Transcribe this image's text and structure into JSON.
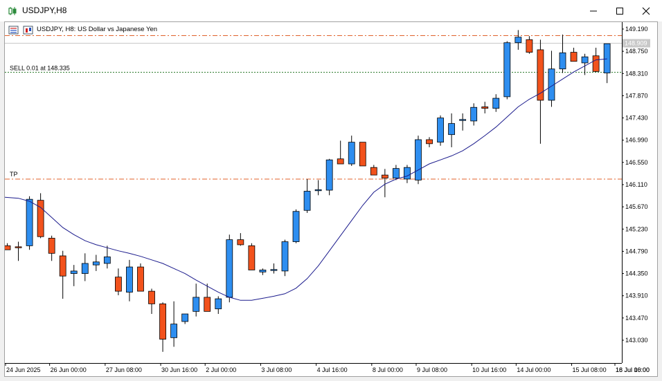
{
  "window": {
    "title": "USDJPY,H8",
    "buttons": [
      "minimize",
      "maximize",
      "close"
    ]
  },
  "chart_header": {
    "symbol_text": "USDJPY, H8:  US Dollar vs Japanese Yen"
  },
  "trade_lines": {
    "sell_label": "SELL 0.01 at 148.335",
    "tp_label": "TP",
    "sell_price": 148.335,
    "tp_price": 146.22,
    "sl_price": 149.06,
    "current_price": 148.909,
    "current_price_label": "148.909"
  },
  "colors": {
    "bull": "#2e8ef0",
    "bear": "#f2521c",
    "ma": "#1a1a8c",
    "tp_sl_line": "#e0602a",
    "sell_line": "#2a7a2a",
    "price_line": "#c8c8c8"
  },
  "chart_data": {
    "type": "candlestick",
    "symbol": "USDJPY",
    "timeframe": "H8",
    "y_axis_ticks": [
      "149.190",
      "148.750",
      "148.310",
      "147.870",
      "147.430",
      "146.990",
      "146.550",
      "146.110",
      "145.670",
      "145.230",
      "144.790",
      "144.350",
      "143.910",
      "143.470",
      "143.030"
    ],
    "x_axis_labels": [
      "24 Jun 2025",
      "26 Jun 00:00",
      "27 Jun 08:00",
      "30 Jun 16:00",
      "2 Jul 00:00",
      "3 Jul 08:00",
      "4 Jul 16:00",
      "8 Jul 00:00",
      "9 Jul 08:00",
      "10 Jul 16:00",
      "14 Jul 00:00",
      "15 Jul 08:00",
      "16 Jul 16:00",
      "18 Jul 00:00"
    ],
    "ylim": [
      142.62,
      149.38
    ],
    "candles": [
      {
        "o": 144.9,
        "h": 144.95,
        "l": 144.82,
        "c": 144.82
      },
      {
        "o": 144.88,
        "h": 144.98,
        "l": 144.6,
        "c": 144.86
      },
      {
        "o": 144.9,
        "h": 145.88,
        "l": 144.82,
        "c": 145.82
      },
      {
        "o": 145.8,
        "h": 145.94,
        "l": 145.05,
        "c": 145.08
      },
      {
        "o": 145.05,
        "h": 145.1,
        "l": 144.6,
        "c": 144.75
      },
      {
        "o": 144.7,
        "h": 144.8,
        "l": 143.85,
        "c": 144.3
      },
      {
        "o": 144.35,
        "h": 144.52,
        "l": 144.1,
        "c": 144.4
      },
      {
        "o": 144.35,
        "h": 144.75,
        "l": 144.2,
        "c": 144.55
      },
      {
        "o": 144.52,
        "h": 144.72,
        "l": 144.4,
        "c": 144.58
      },
      {
        "o": 144.55,
        "h": 144.9,
        "l": 144.45,
        "c": 144.68
      },
      {
        "o": 144.28,
        "h": 144.45,
        "l": 143.92,
        "c": 144.0
      },
      {
        "o": 143.98,
        "h": 144.62,
        "l": 143.8,
        "c": 144.48
      },
      {
        "o": 144.48,
        "h": 144.55,
        "l": 144.0,
        "c": 144.0
      },
      {
        "o": 144.0,
        "h": 144.05,
        "l": 143.55,
        "c": 143.75
      },
      {
        "o": 143.75,
        "h": 143.78,
        "l": 142.8,
        "c": 143.05
      },
      {
        "o": 143.08,
        "h": 143.8,
        "l": 142.9,
        "c": 143.35
      },
      {
        "o": 143.4,
        "h": 143.55,
        "l": 143.35,
        "c": 143.55
      },
      {
        "o": 143.6,
        "h": 144.15,
        "l": 143.5,
        "c": 143.88
      },
      {
        "o": 143.88,
        "h": 144.15,
        "l": 143.6,
        "c": 143.6
      },
      {
        "o": 143.65,
        "h": 143.9,
        "l": 143.55,
        "c": 143.85
      },
      {
        "o": 143.88,
        "h": 145.12,
        "l": 143.78,
        "c": 145.02
      },
      {
        "o": 145.02,
        "h": 145.15,
        "l": 144.9,
        "c": 144.92
      },
      {
        "o": 144.9,
        "h": 144.95,
        "l": 144.42,
        "c": 144.42
      },
      {
        "o": 144.38,
        "h": 144.45,
        "l": 144.32,
        "c": 144.42
      },
      {
        "o": 144.43,
        "h": 144.55,
        "l": 144.35,
        "c": 144.43
      },
      {
        "o": 144.4,
        "h": 145.02,
        "l": 144.3,
        "c": 144.98
      },
      {
        "o": 144.98,
        "h": 145.62,
        "l": 144.95,
        "c": 145.58
      },
      {
        "o": 145.6,
        "h": 146.22,
        "l": 145.55,
        "c": 145.98
      },
      {
        "o": 146.0,
        "h": 146.2,
        "l": 145.9,
        "c": 146.01
      },
      {
        "o": 146.0,
        "h": 146.62,
        "l": 145.9,
        "c": 146.6
      },
      {
        "o": 146.62,
        "h": 146.98,
        "l": 146.52,
        "c": 146.52
      },
      {
        "o": 146.52,
        "h": 147.08,
        "l": 146.48,
        "c": 146.95
      },
      {
        "o": 146.95,
        "h": 146.95,
        "l": 146.48,
        "c": 146.48
      },
      {
        "o": 146.45,
        "h": 146.5,
        "l": 146.3,
        "c": 146.3
      },
      {
        "o": 146.3,
        "h": 146.42,
        "l": 145.86,
        "c": 146.24
      },
      {
        "o": 146.24,
        "h": 146.5,
        "l": 146.2,
        "c": 146.43
      },
      {
        "o": 146.22,
        "h": 146.5,
        "l": 146.14,
        "c": 146.45
      },
      {
        "o": 146.2,
        "h": 147.08,
        "l": 146.12,
        "c": 147.0
      },
      {
        "o": 147.0,
        "h": 147.05,
        "l": 146.85,
        "c": 146.92
      },
      {
        "o": 146.95,
        "h": 147.48,
        "l": 146.88,
        "c": 147.43
      },
      {
        "o": 147.1,
        "h": 147.52,
        "l": 146.85,
        "c": 147.32
      },
      {
        "o": 147.4,
        "h": 147.52,
        "l": 147.18,
        "c": 147.4
      },
      {
        "o": 147.37,
        "h": 147.72,
        "l": 147.28,
        "c": 147.64
      },
      {
        "o": 147.65,
        "h": 147.75,
        "l": 147.52,
        "c": 147.62
      },
      {
        "o": 147.62,
        "h": 147.9,
        "l": 147.55,
        "c": 147.82
      },
      {
        "o": 147.85,
        "h": 148.95,
        "l": 147.8,
        "c": 148.92
      },
      {
        "o": 148.92,
        "h": 149.17,
        "l": 148.78,
        "c": 149.03
      },
      {
        "o": 148.98,
        "h": 149.05,
        "l": 148.7,
        "c": 148.73
      },
      {
        "o": 148.78,
        "h": 148.98,
        "l": 146.92,
        "c": 147.78
      },
      {
        "o": 147.78,
        "h": 148.76,
        "l": 147.65,
        "c": 148.4
      },
      {
        "o": 148.4,
        "h": 149.08,
        "l": 148.32,
        "c": 148.72
      },
      {
        "o": 148.73,
        "h": 148.82,
        "l": 148.55,
        "c": 148.55
      },
      {
        "o": 148.52,
        "h": 148.7,
        "l": 148.28,
        "c": 148.64
      },
      {
        "o": 148.66,
        "h": 148.82,
        "l": 148.34,
        "c": 148.35
      },
      {
        "o": 148.32,
        "h": 148.9,
        "l": 148.12,
        "c": 148.9
      }
    ],
    "ma": [
      145.86,
      145.84,
      145.78,
      145.66,
      145.46,
      145.26,
      145.12,
      145.0,
      144.92,
      144.86,
      144.8,
      144.75,
      144.69,
      144.62,
      144.55,
      144.45,
      144.35,
      144.22,
      144.1,
      143.98,
      143.88,
      143.82,
      143.82,
      143.86,
      143.9,
      143.95,
      144.06,
      144.25,
      144.5,
      144.8,
      145.1,
      145.4,
      145.7,
      145.96,
      146.12,
      146.22,
      146.28,
      146.4,
      146.52,
      146.6,
      146.68,
      146.78,
      146.92,
      147.08,
      147.25,
      147.45,
      147.65,
      147.8,
      147.92,
      148.06,
      148.2,
      148.34,
      148.46,
      148.58,
      148.6
    ]
  }
}
